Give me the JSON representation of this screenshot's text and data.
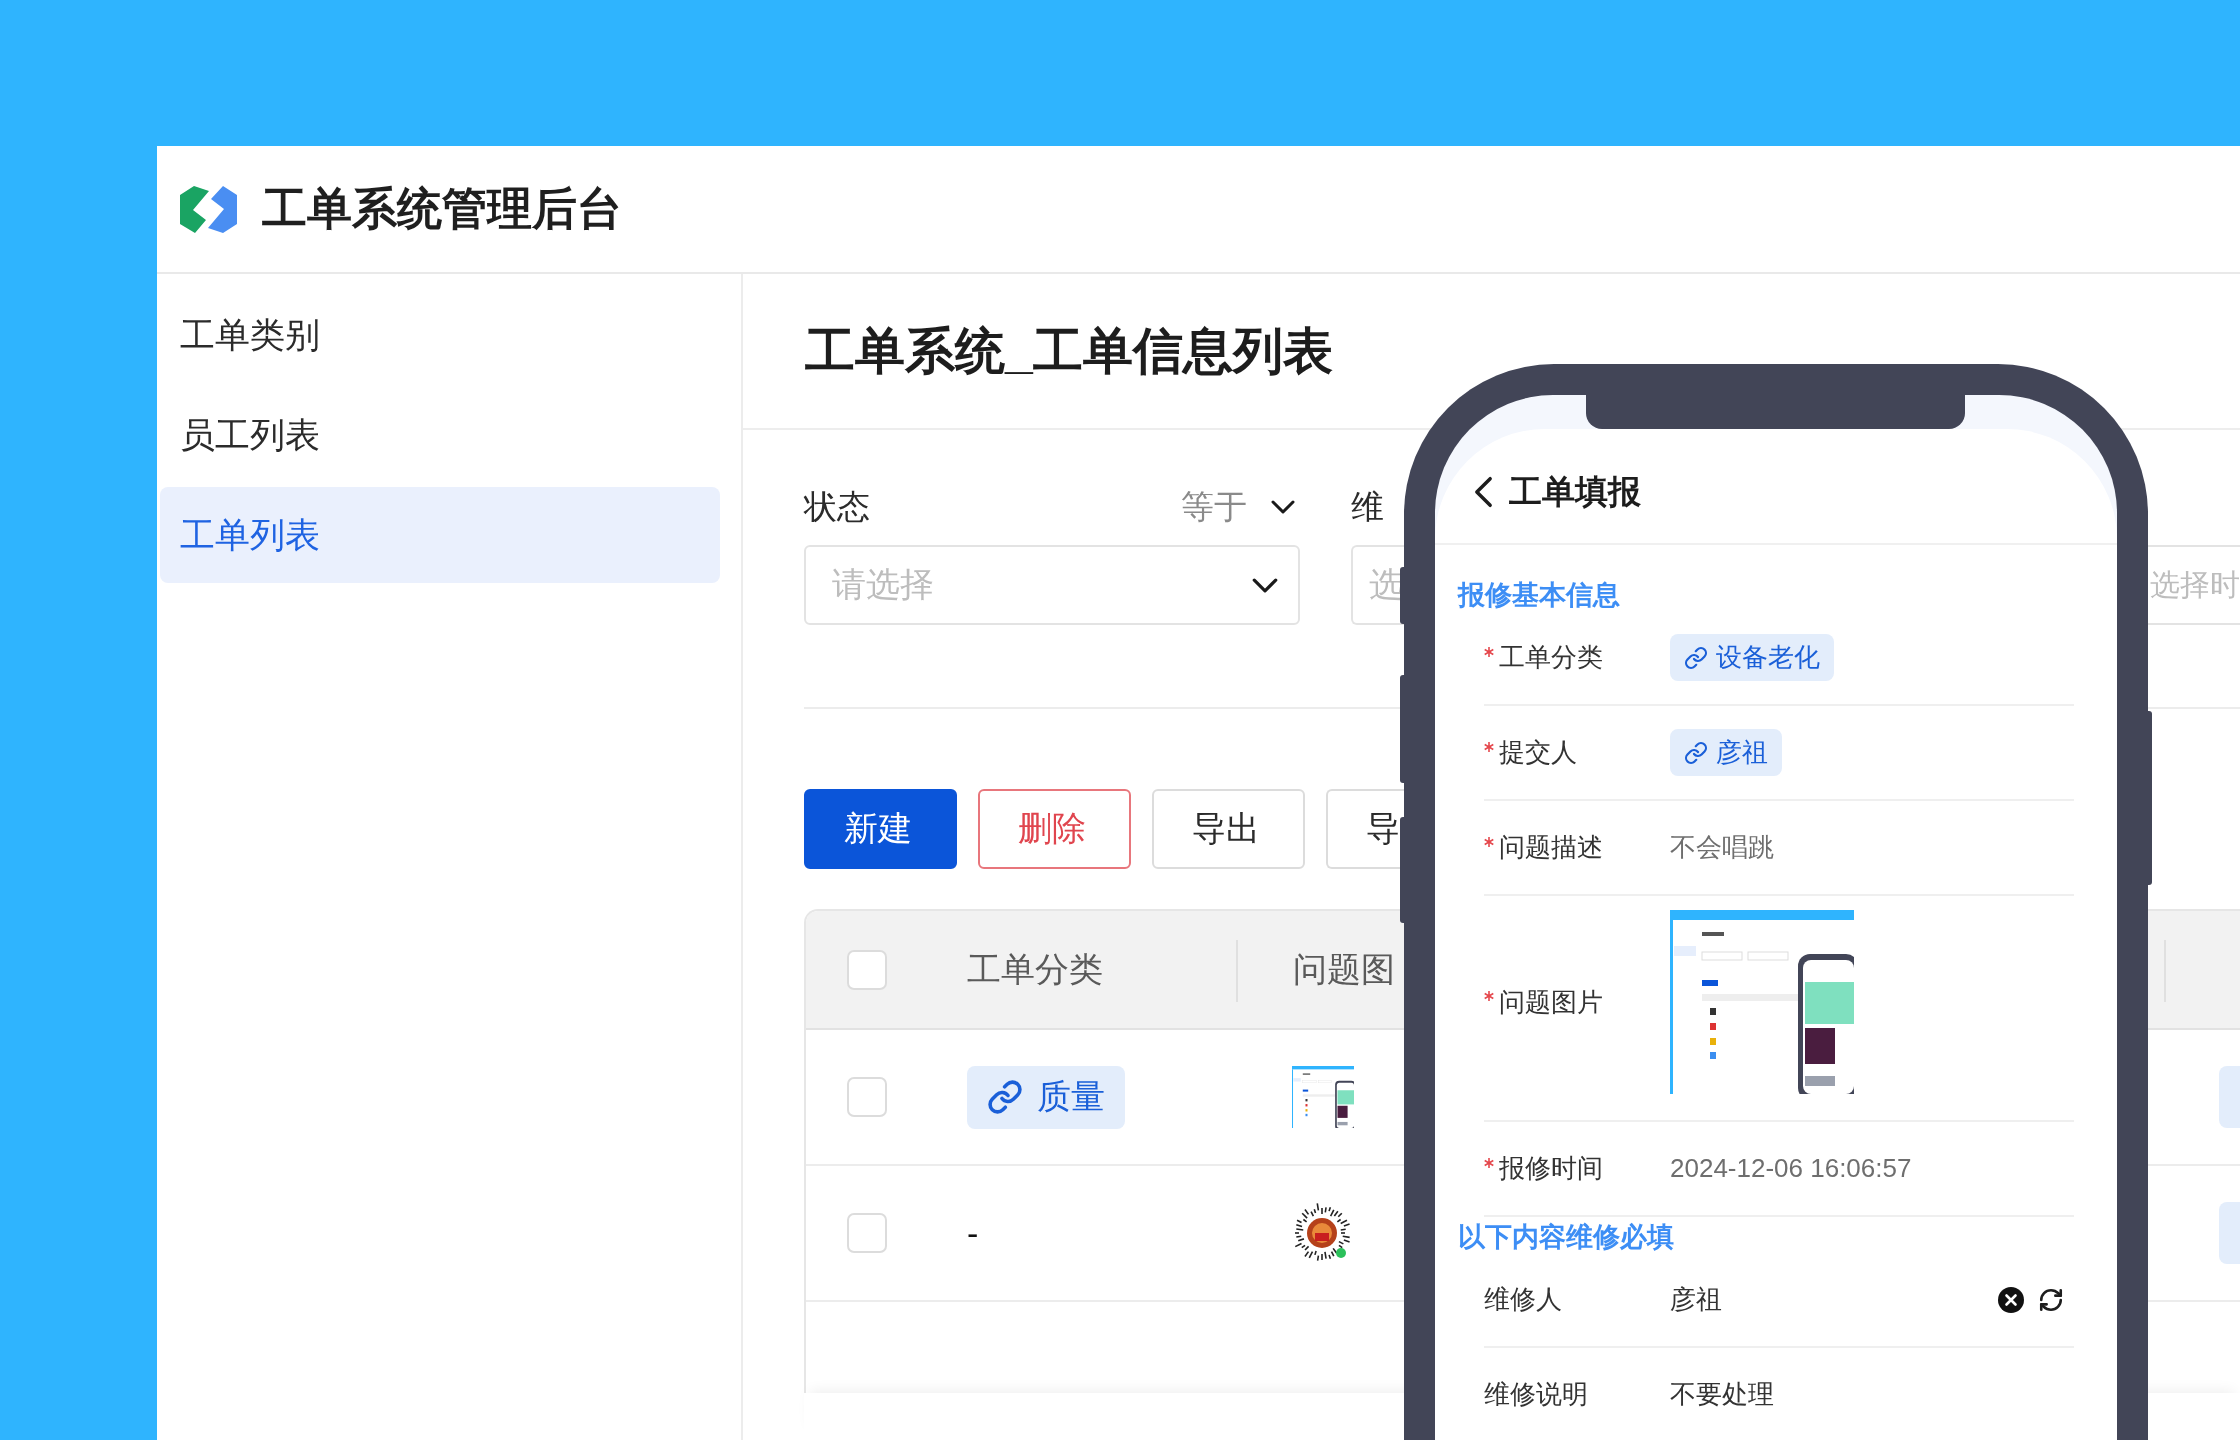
{
  "app": {
    "title": "工单系统管理后台"
  },
  "sidebar": {
    "items": [
      {
        "label": "工单类别",
        "selected": false
      },
      {
        "label": "员工列表",
        "selected": false
      },
      {
        "label": "工单列表",
        "selected": true
      }
    ]
  },
  "page": {
    "title": "工单系统_工单信息列表"
  },
  "filters": [
    {
      "kind": "select",
      "label": "状态",
      "operator": "等于",
      "placeholder": "请选择"
    },
    {
      "kind": "input",
      "label": "维",
      "placeholder": "选"
    },
    {
      "kind": "date",
      "placeholder": "选择时"
    }
  ],
  "toolbar": {
    "buttons": [
      {
        "label": "新建",
        "kind": "primary"
      },
      {
        "label": "删除",
        "kind": "danger"
      },
      {
        "label": "导出",
        "kind": "default"
      },
      {
        "label": "导",
        "kind": "default"
      }
    ]
  },
  "table": {
    "select_all": {
      "checked": false
    },
    "columns": [
      "工单分类",
      "问题图"
    ],
    "rows": [
      {
        "checked": false,
        "category": {
          "kind": "tag",
          "text": "质量"
        },
        "image": {
          "kind": "screenshot"
        }
      },
      {
        "checked": false,
        "category": {
          "kind": "text",
          "text": "-"
        },
        "image": {
          "kind": "qr-code"
        }
      }
    ]
  },
  "phone": {
    "title": "工单填报",
    "sections": [
      {
        "title": "报修基本信息",
        "fields": [
          {
            "label": "工单分类",
            "required": true,
            "kind": "tag",
            "value": "设备老化"
          },
          {
            "label": "提交人",
            "required": true,
            "kind": "tag",
            "value": "彦祖"
          },
          {
            "label": "问题描述",
            "required": true,
            "kind": "text",
            "value": "不会唱跳"
          },
          {
            "label": "问题图片",
            "required": true,
            "kind": "image"
          },
          {
            "label": "报修时间",
            "required": true,
            "kind": "text",
            "value": "2024-12-06 16:06:57"
          }
        ]
      },
      {
        "title": "以下内容维修必填",
        "fields": [
          {
            "label": "维修人",
            "required": false,
            "kind": "picker",
            "value": "彦祖"
          },
          {
            "label": "维修说明",
            "required": false,
            "kind": "input",
            "value": "不要处理"
          }
        ]
      }
    ]
  }
}
